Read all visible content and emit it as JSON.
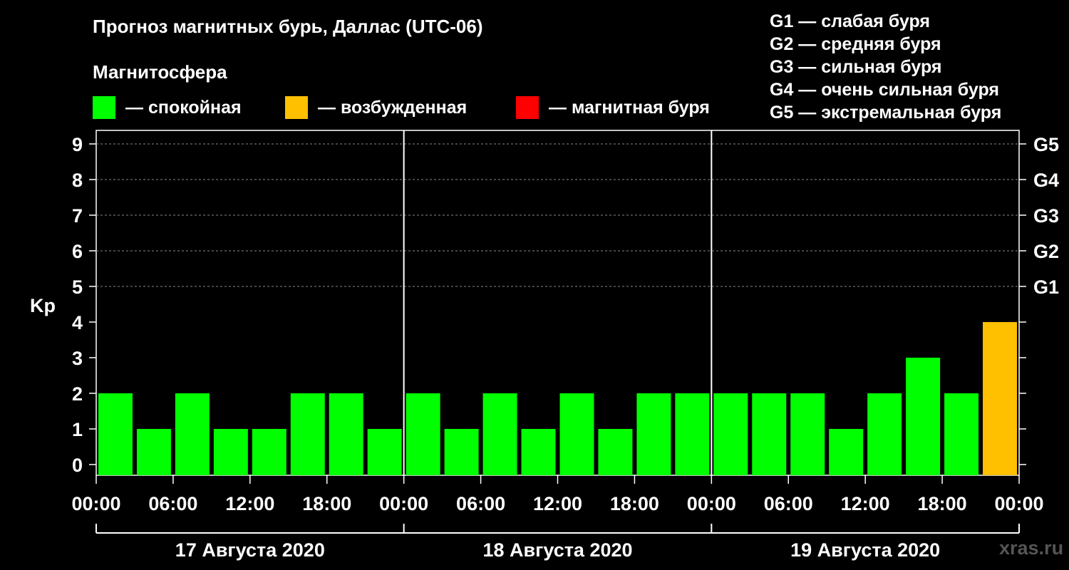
{
  "title": "Прогноз магнитных бурь, Даллас (UTC-06)",
  "subtitle": "Магнитосфера",
  "legend": [
    {
      "label": "— спокойная",
      "color": "#00ff00"
    },
    {
      "label": "— возбужденная",
      "color": "#ffc000"
    },
    {
      "label": "— магнитная буря",
      "color": "#ff0000"
    }
  ],
  "storm_legend": [
    "G1 — слабая буря",
    "G2 — средняя буря",
    "G3 — сильная буря",
    "G4 — очень сильная буря",
    "G5 — экстремальная буря"
  ],
  "watermark": "xras.ru",
  "chart_data": {
    "type": "bar",
    "ylabel": "Kp",
    "ylim": [
      0,
      9
    ],
    "yticks": [
      "0",
      "1",
      "2",
      "3",
      "4",
      "5",
      "6",
      "7",
      "8",
      "9"
    ],
    "g_levels": [
      {
        "label": "G1",
        "kp": 5
      },
      {
        "label": "G2",
        "kp": 6
      },
      {
        "label": "G3",
        "kp": 7
      },
      {
        "label": "G4",
        "kp": 8
      },
      {
        "label": "G5",
        "kp": 9
      }
    ],
    "xtick_labels": [
      "00:00",
      "06:00",
      "12:00",
      "18:00",
      "00:00",
      "06:00",
      "12:00",
      "18:00",
      "00:00",
      "06:00",
      "12:00",
      "18:00",
      "00:00"
    ],
    "days": [
      "17 Августа 2020",
      "18 Августа 2020",
      "19 Августа 2020"
    ],
    "values": [
      2,
      1,
      2,
      1,
      1,
      2,
      2,
      1,
      2,
      1,
      2,
      1,
      2,
      1,
      2,
      2,
      2,
      2,
      2,
      1,
      2,
      3,
      2,
      4
    ],
    "levels": [
      "quiet",
      "quiet",
      "quiet",
      "quiet",
      "quiet",
      "quiet",
      "quiet",
      "quiet",
      "quiet",
      "quiet",
      "quiet",
      "quiet",
      "quiet",
      "quiet",
      "quiet",
      "quiet",
      "quiet",
      "quiet",
      "quiet",
      "quiet",
      "quiet",
      "quiet",
      "quiet",
      "active"
    ],
    "colors": {
      "quiet": "#00ff00",
      "active": "#ffc000",
      "storm": "#ff0000"
    },
    "grid": true
  }
}
